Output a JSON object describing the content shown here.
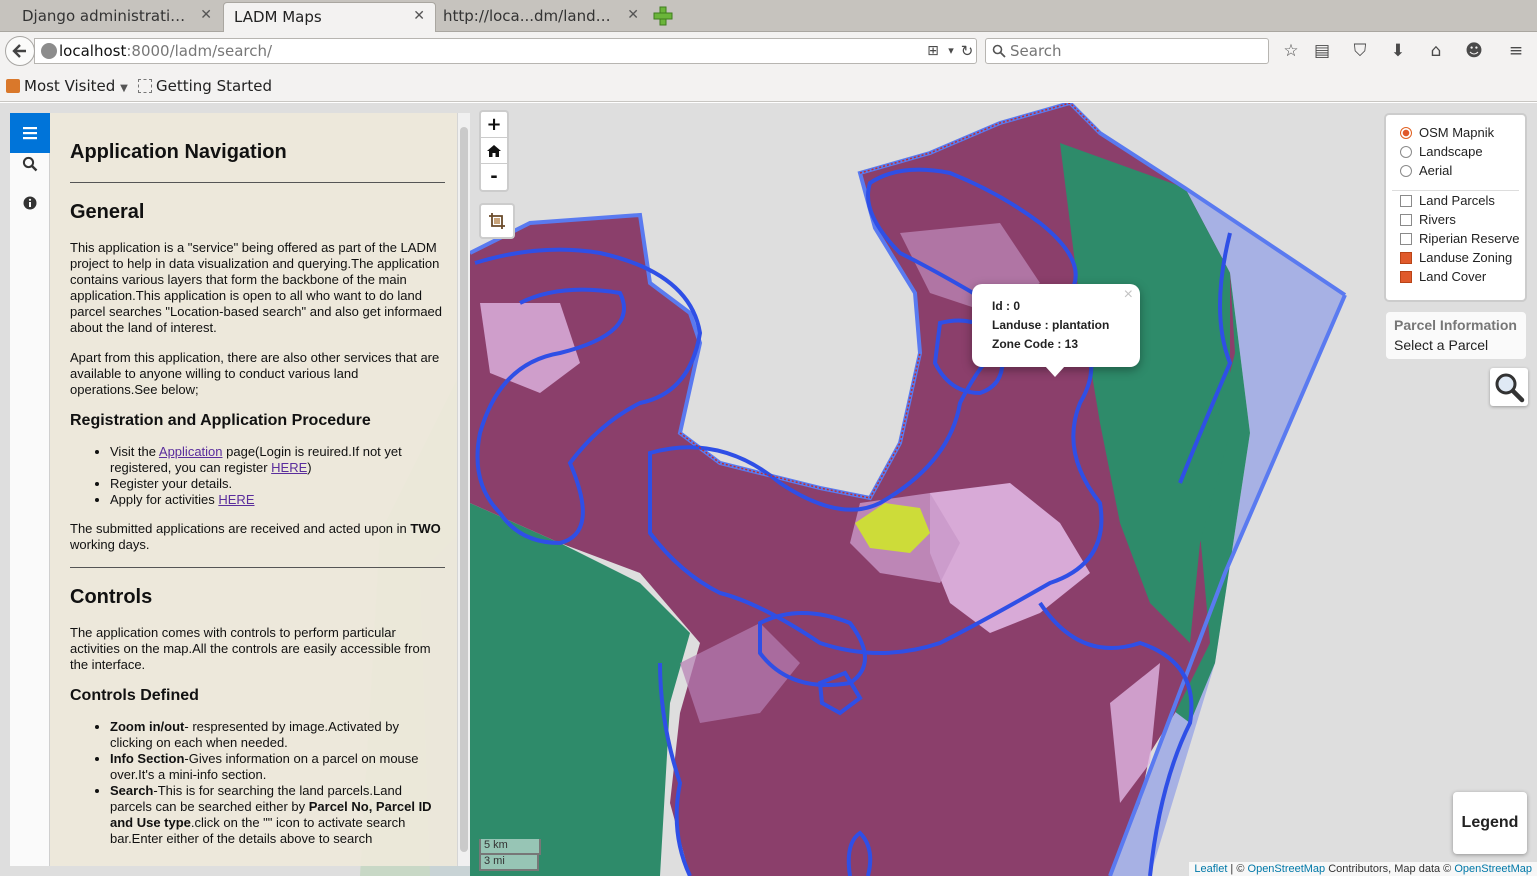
{
  "browser": {
    "tabs": [
      {
        "label": "Django administration |...",
        "active": false
      },
      {
        "label": "LADM Maps",
        "active": true
      },
      {
        "label": "http://loca...dm/landuse/",
        "active": false
      }
    ],
    "url_host": "localhost",
    "url_rest": ":8000/ladm/search/",
    "search_placeholder": "Search",
    "bookmarks": [
      "Most Visited",
      "Getting Started"
    ]
  },
  "sidebar": {
    "tabs": [
      "menu-icon",
      "search-icon",
      "info-icon"
    ],
    "title": "Application Navigation",
    "general": {
      "heading": "General",
      "para1": "This application is a \"service\" being offered as part of the LADM project to help in data visualization and querying.The application contains various layers that form the backbone of the main application.This application is open to all who want to do land parcel searches \"Location-based search\" and also get informaed about the land of interest.",
      "para2": "Apart from this application, there are also other services that are available to anyone willing to conduct various land operations.See below;"
    },
    "registration": {
      "heading": "Registration and Application Procedure",
      "item1_pre": "Visit the ",
      "item1_link": "Application",
      "item1_mid": " page(Login is reuired.If not yet registered, you can register ",
      "item1_link2": "HERE",
      "item1_post": ")",
      "item2": "Register your details.",
      "item3_pre": "Apply for activities ",
      "item3_link": "HERE",
      "footer_pre": "The submitted applications are received and acted upon in ",
      "footer_bold": "TWO",
      "footer_post": " working days."
    },
    "controls": {
      "heading": "Controls",
      "para": "The application comes with controls to perform particular activities on the map.All the controls are easily accessible from the interface.",
      "subheading": "Controls Defined",
      "zoom_bold": "Zoom in/out",
      "zoom_text": "- respresented by image.Activated by clicking on each when needed.",
      "info_bold": "Info Section",
      "info_text": "-Gives information on a parcel on mouse over.It's a mini-info section.",
      "search_bold": "Search",
      "search_text1": "-This is for searching the land parcels.Land parcels can be searched either by ",
      "search_bold2": "Parcel No, Parcel ID and Use type",
      "search_text2": ".click on the \"\" icon to activate search bar.Enter either of the details above to search"
    }
  },
  "map": {
    "zoom_in": "+",
    "zoom_out": "-",
    "base_layers": [
      {
        "label": "OSM Mapnik",
        "checked": true
      },
      {
        "label": "Landscape",
        "checked": false
      },
      {
        "label": "Aerial",
        "checked": false
      }
    ],
    "overlays": [
      {
        "label": "Land Parcels",
        "checked": false
      },
      {
        "label": "Rivers",
        "checked": false
      },
      {
        "label": "Riperian Reserve",
        "checked": false
      },
      {
        "label": "Landuse Zoning",
        "checked": true
      },
      {
        "label": "Land Cover",
        "checked": true
      }
    ],
    "parcel_info_title": "Parcel Information",
    "parcel_info_text": "Select a Parcel",
    "popup": {
      "id": "Id : 0",
      "landuse": "Landuse : plantation",
      "zone": "Zone Code : 13",
      "close": "×"
    },
    "legend": "Legend",
    "scale_km": "5 km",
    "scale_mi": "3 mi",
    "attribution": {
      "leaflet": "Leaflet",
      "sep1": " | © ",
      "osm": "OpenStreetMap",
      "mid": " Contributors, Map data © ",
      "osm2": "OpenStreetMap"
    },
    "colors": {
      "zoning_purple": "#8b3f6b",
      "forest_green": "#2e8b6a",
      "water_blue": "#a9b3e6",
      "boundary_blue": "#2f4fe6",
      "highlight_yellow": "#cddc39",
      "light_pink": "#e0b6e3"
    }
  }
}
